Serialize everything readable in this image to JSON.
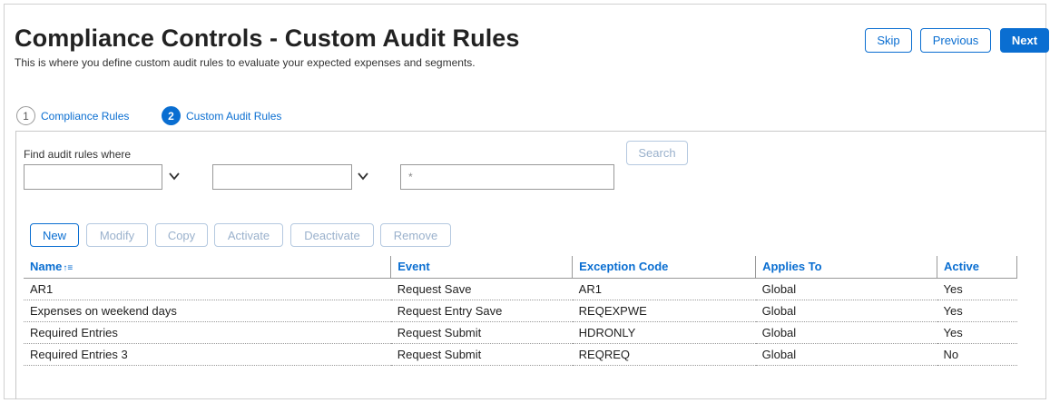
{
  "header": {
    "title": "Compliance Controls - Custom Audit Rules",
    "subtitle": "This is where you define custom audit rules to evaluate your expected expenses and segments."
  },
  "nav_buttons": {
    "skip": "Skip",
    "previous": "Previous",
    "next": "Next"
  },
  "steps": [
    {
      "number": "1",
      "label": "Compliance Rules"
    },
    {
      "number": "2",
      "label": "Custom Audit Rules"
    }
  ],
  "search": {
    "label": "Find audit rules where",
    "field1_value": "",
    "field2_value": "",
    "text_value": "*",
    "button": "Search"
  },
  "actions": {
    "new": "New",
    "modify": "Modify",
    "copy": "Copy",
    "activate": "Activate",
    "deactivate": "Deactivate",
    "remove": "Remove"
  },
  "table": {
    "columns": [
      "Name",
      "Event",
      "Exception Code",
      "Applies To",
      "Active"
    ],
    "sort_indicator": "↑≡",
    "rows": [
      [
        "AR1",
        "Request Save",
        "AR1",
        "Global",
        "Yes"
      ],
      [
        "Expenses on weekend days",
        "Request Entry Save",
        "REQEXPWE",
        "Global",
        "Yes"
      ],
      [
        "Required Entries",
        "Request Submit",
        "HDRONLY",
        "Global",
        "Yes"
      ],
      [
        "Required Entries 3",
        "Request Submit",
        "REQREQ",
        "Global",
        "No"
      ]
    ]
  },
  "colors": {
    "accent": "#0a6ed1",
    "disabled": "#9ab1cc"
  }
}
